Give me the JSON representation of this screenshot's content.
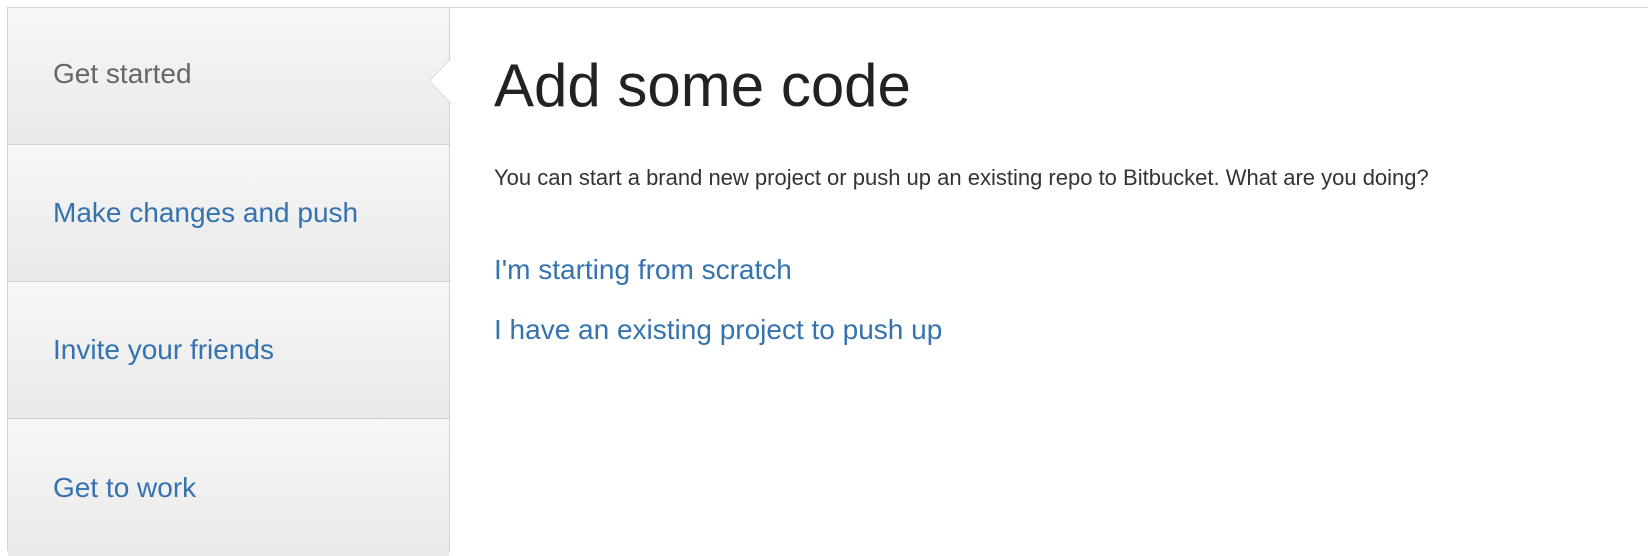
{
  "sidebar": {
    "steps": [
      {
        "label": "Get started",
        "active": true
      },
      {
        "label": "Make changes and push",
        "active": false
      },
      {
        "label": "Invite your friends",
        "active": false
      },
      {
        "label": "Get to work",
        "active": false
      }
    ]
  },
  "main": {
    "title": "Add some code",
    "description": "You can start a brand new project or push up an existing repo to Bitbucket. What are you doing?",
    "options": [
      {
        "label": "I'm starting from scratch"
      },
      {
        "label": "I have an existing project to push up"
      }
    ]
  },
  "colors": {
    "link": "#3572b0",
    "active_step_text": "#666666",
    "heading": "#222222",
    "border": "#d2d2d2"
  }
}
